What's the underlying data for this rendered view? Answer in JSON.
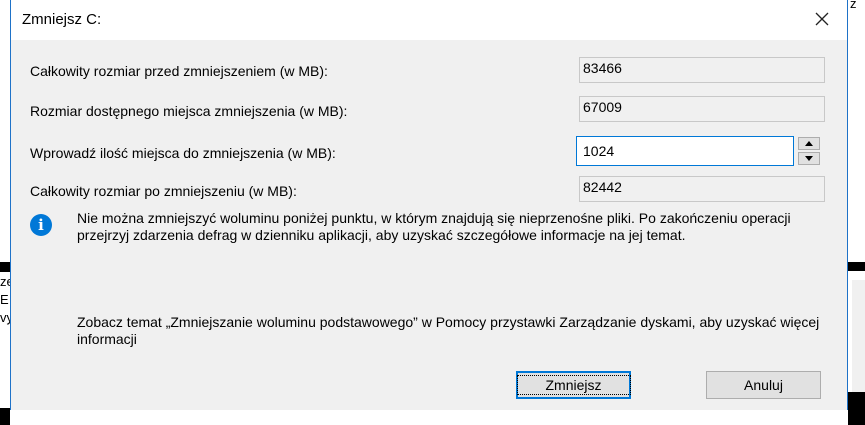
{
  "dialog": {
    "title": "Zmniejsz C:",
    "fields": [
      {
        "label": "Całkowity rozmiar przed zmniejszeniem (w MB):",
        "value": "83466"
      },
      {
        "label": "Rozmiar dostępnego miejsca zmniejszenia (w MB):",
        "value": "67009"
      },
      {
        "label": "Wprowadź ilość miejsca do zmniejszenia (w MB):",
        "value": "1024"
      },
      {
        "label": "Całkowity rozmiar po zmniejszeniu (w MB):",
        "value": "82442"
      }
    ],
    "info_text": "Nie można zmniejszyć woluminu poniżej punktu, w którym znajdują się nieprzenośne pliki. Po zakończeniu operacji przejrzyj zdarzenia defrag w dzienniku aplikacji, aby uzyskać szczegółowe informacje na jej temat.",
    "help_text": "Zobacz temat „Zmniejszanie woluminu podstawowego” w Pomocy przystawki Zarządzanie dyskami, aby uzyskać więcej informacji",
    "buttons": {
      "shrink": "Zmniejsz",
      "cancel": "Anuluj"
    }
  },
  "background": {
    "left_fragments": [
      "ze",
      "E",
      "vy"
    ],
    "right_fragment": "z"
  },
  "colors": {
    "accent": "#0078d7",
    "dialog_bg": "#f0f0f0"
  }
}
